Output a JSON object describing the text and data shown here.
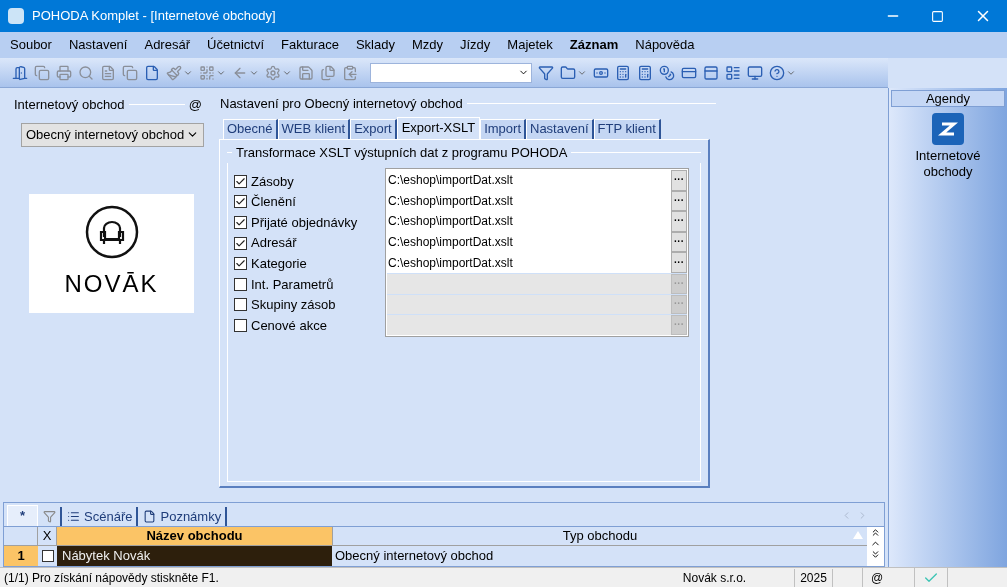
{
  "window": {
    "title": "POHODA Komplet - [Internetové obchody]"
  },
  "menu": [
    {
      "label": "Soubor",
      "bold": false
    },
    {
      "label": "Nastavení",
      "bold": false
    },
    {
      "label": "Adresář",
      "bold": false
    },
    {
      "label": "Účetnictví",
      "bold": false
    },
    {
      "label": "Fakturace",
      "bold": false
    },
    {
      "label": "Sklady",
      "bold": false
    },
    {
      "label": "Mzdy",
      "bold": false
    },
    {
      "label": "Jízdy",
      "bold": false
    },
    {
      "label": "Majetek",
      "bold": false
    },
    {
      "label": "Záznam",
      "bold": true
    },
    {
      "label": "Nápověda",
      "bold": false
    }
  ],
  "left_panel": {
    "title": "Internetový obchod",
    "at_sign": "@",
    "shop_type": "Obecný internetový obchod",
    "logo_text": "NOVĀK"
  },
  "settings": {
    "title": "Nastavení pro Obecný internetový obchod",
    "tabs": [
      {
        "label": "Obecné",
        "selected": false
      },
      {
        "label": "WEB klient",
        "selected": false
      },
      {
        "label": "Export",
        "selected": false
      },
      {
        "label": "Export-XSLT",
        "selected": true
      },
      {
        "label": "Import",
        "selected": false
      },
      {
        "label": "Nastavení",
        "selected": false
      },
      {
        "label": "FTP klient",
        "selected": false
      }
    ],
    "group_title": "Transformace XSLT výstupních dat z programu POHODA",
    "rows": [
      {
        "label": "Zásoby",
        "checked": true,
        "path": "C:\\eshop\\importDat.xslt"
      },
      {
        "label": "Členění",
        "checked": true,
        "path": "C:\\eshop\\importDat.xslt"
      },
      {
        "label": "Přijaté objednávky",
        "checked": true,
        "path": "C:\\eshop\\importDat.xslt"
      },
      {
        "label": "Adresář",
        "checked": true,
        "path": "C:\\eshop\\importDat.xslt"
      },
      {
        "label": "Kategorie",
        "checked": true,
        "path": "C:\\eshop\\importDat.xslt"
      },
      {
        "label": "Int. Parametrů",
        "checked": false
      },
      {
        "label": "Skupiny zásob",
        "checked": false
      },
      {
        "label": "Cenové akce",
        "checked": false
      }
    ],
    "browse_label": "···"
  },
  "agendy": {
    "title": "Agendy",
    "item": "Internetové obchody"
  },
  "bottom_tabs": [
    {
      "kind": "star",
      "label": "*",
      "selected": true
    },
    {
      "kind": "filter",
      "selected": false
    },
    {
      "kind": "list",
      "label": "Scénáře",
      "selected": false
    },
    {
      "kind": "page",
      "label": "Poznámky",
      "selected": false
    }
  ],
  "table": {
    "columns": [
      "X",
      "Název obchodu",
      "Typ obchodu"
    ],
    "rows": [
      {
        "number": "1",
        "checked": false,
        "name": "Nábytek Novák",
        "type": "Obecný internetový obchod",
        "selected": true
      }
    ]
  },
  "status_bar": {
    "message": "(1/1) Pro získání nápovědy stiskněte F1.",
    "company": "Novák s.r.o.",
    "year": "2025",
    "at_sign": "@"
  }
}
